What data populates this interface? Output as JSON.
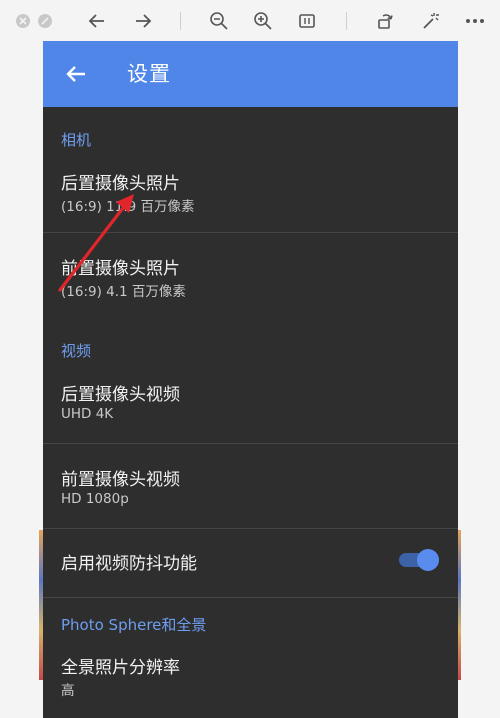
{
  "colors": {
    "appbar": "#4f86e8",
    "background": "#2e2e2e",
    "section_title": "#6f9ef0",
    "toggle_on": "#5a8cf0",
    "annotation_arrow": "#e0262a"
  },
  "viewer_toolbar": {
    "icons": [
      "close-window-icon",
      "stop-icon",
      "back-arrow-icon",
      "forward-arrow-icon",
      "zoom-out-icon",
      "zoom-in-icon",
      "fit-page-icon",
      "rotate-icon",
      "magic-wand-icon",
      "more-icon"
    ]
  },
  "appbar": {
    "back_icon": "arrow-left-icon",
    "title": "设置"
  },
  "sections": {
    "camera": "相机",
    "video": "视频",
    "photosphere": "Photo Sphere和全景"
  },
  "items": {
    "rear_photo": {
      "title": "后置摄像头照片",
      "value": "(16:9) 11.9 百万像素"
    },
    "front_photo": {
      "title": "前置摄像头照片",
      "value": "(16:9) 4.1 百万像素"
    },
    "rear_video": {
      "title": "后置摄像头视频",
      "value": "UHD 4K"
    },
    "front_video": {
      "title": "前置摄像头视频",
      "value": "HD 1080p"
    },
    "stabilization": {
      "title": "启用视频防抖功能",
      "enabled": true
    },
    "panorama_res": {
      "title": "全景照片分辨率",
      "value": "高"
    }
  }
}
